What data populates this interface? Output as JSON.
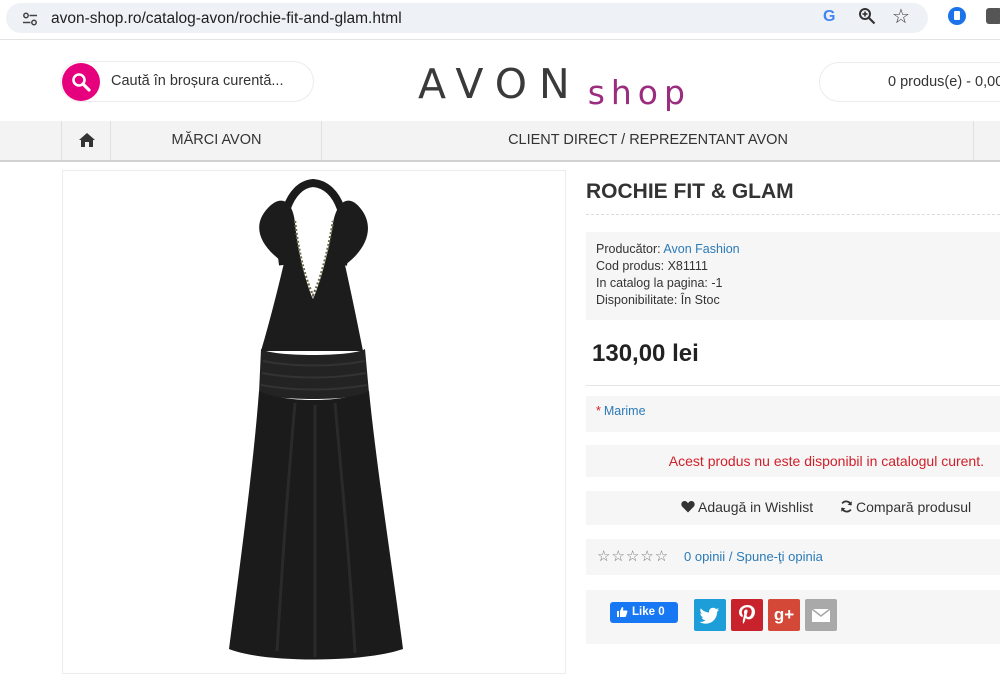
{
  "browser": {
    "url": "avon-shop.ro/catalog-avon/rochie-fit-and-glam.html",
    "google_glyph": "G"
  },
  "header": {
    "search_placeholder": "Caută în broșura curentă...",
    "logo_main": "AVON",
    "logo_sub": "shop",
    "cart_text": "0 produs(e) - 0,00"
  },
  "nav": {
    "home_icon": "home-icon",
    "items": [
      {
        "label": "MĂRCI AVON"
      },
      {
        "label": "CLIENT DIRECT / REPREZENTANT AVON"
      }
    ]
  },
  "product": {
    "title": "ROCHIE FIT & GLAM",
    "producer_label": "Producător:",
    "producer_value": "Avon Fashion",
    "code_label": "Cod produs:",
    "code_value": "X81111",
    "catalog_label": "In catalog la pagina:",
    "catalog_value": "-1",
    "availability_label": "Disponibilitate:",
    "availability_value": "În Stoc",
    "price": "130,00 lei",
    "size_required_mark": "*",
    "size_label": "Marime",
    "alert": "Acest produs nu este disponibil in catalogul curent.",
    "wishlist_label": "Adaugă in Wishlist",
    "compare_label": "Compară produsul",
    "rating_stars": "☆☆☆☆☆",
    "reviews_count": "0 opinii",
    "reviews_separator": "/",
    "write_review": "Spune-ţi opinia",
    "fb_like": "Like 0"
  },
  "colors": {
    "brand_pink": "#e6007e",
    "logo_purple": "#9b2d7f",
    "link_blue": "#2b7ab8",
    "alert_red": "#d0202a"
  }
}
